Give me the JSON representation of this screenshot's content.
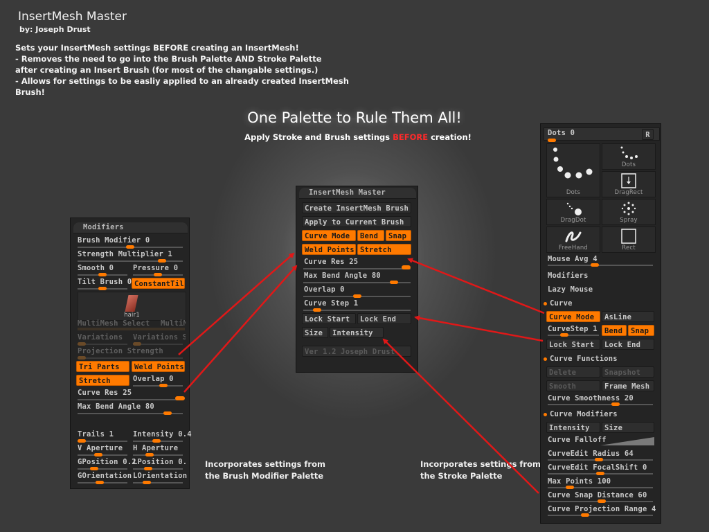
{
  "header": {
    "title": "InsertMesh Master",
    "author": "by: Joseph Drust",
    "description": [
      "Sets your InsertMesh settings BEFORE creating an InsertMesh!",
      "- Removes the need to go into the Brush Palette AND Stroke Palette",
      "after creating an Insert Brush (for most of the changable settings.)",
      "- Allows for settings to be easliy applied to an already created InsertMesh",
      "Brush!"
    ],
    "headline": "One Palette to Rule Them All!",
    "subline_pre": "Apply  Stroke and Brush settings ",
    "subline_accent": "BEFORE",
    "subline_post": " creation!",
    "accent_color": "#ff2a2a"
  },
  "captions": {
    "left_line1": "Incorporates settings from",
    "left_line2": "the Brush Modifier Palette",
    "right_line1": "Incorporates settings from",
    "right_line2": "the Stroke Palette"
  },
  "modifiers_palette": {
    "title": "Modifiers",
    "brush_modifier": "Brush Modifier 0",
    "strength_multiplier": "Strength Multiplier 1",
    "smooth": "Smooth 0",
    "pressure": "Pressure 0",
    "tilt_brush": "Tilt Brush 0",
    "constant_tilt": "ConstantTilt",
    "thumb_name": "hair1",
    "multimesh_select": "MultiMesh Select",
    "multim": "MultiM",
    "variations": "Variations",
    "variations_s": "Variations S",
    "projection_strength": "Projection Strength",
    "tri_parts": "Tri Parts",
    "weld_points": "Weld Points",
    "stretch": "Stretch",
    "overlap": "Overlap 0",
    "curve_res": "Curve Res 25",
    "max_bend_angle": "Max Bend Angle 80",
    "trails": "Trails 1",
    "intensity": "Intensity 0.4",
    "v_aperture": "V Aperture",
    "h_aperture": "H Aperture",
    "gposition": "GPosition 0.2",
    "lposition": "LPosition 0.2",
    "gorientation": "GOrientation",
    "lorientation": "LOrientation"
  },
  "master_palette": {
    "title": "InsertMesh Master",
    "create_button": "Create InsertMesh Brush",
    "apply_button": "Apply to Current Brush",
    "curve_mode": "Curve Mode",
    "bend": "Bend",
    "snap": "Snap",
    "weld_points": "Weld Points",
    "stretch": "Stretch",
    "curve_res": "Curve Res 25",
    "max_bend_angle": "Max Bend Angle 80",
    "overlap": "Overlap 0",
    "curve_step": "Curve Step 1",
    "lock_start": "Lock Start",
    "lock_end": "Lock End",
    "size": "Size",
    "intensity": "Intensity",
    "version": "Ver 1.2 Joseph Drust"
  },
  "stroke_palette": {
    "dots": "Dots 0",
    "r_button": "R",
    "strokes": [
      "Dots",
      "Dots",
      "DragRect",
      "DragDot",
      "Spray",
      "FreeHand",
      "Rect"
    ],
    "mouse_avg": "Mouse Avg 4",
    "modifiers": "Modifiers",
    "lazy_mouse": "Lazy Mouse",
    "curve": "Curve",
    "curve_mode": "Curve Mode",
    "asline": "AsLine",
    "curvestep": "CurveStep 1",
    "bend": "Bend",
    "snap": "Snap",
    "lock_start": "Lock Start",
    "lock_end": "Lock End",
    "curve_functions": "Curve Functions",
    "delete": "Delete",
    "snapshot": "Snapshot",
    "smooth": "Smooth",
    "frame_mesh": "Frame Mesh",
    "curve_smoothness": "Curve Smoothness 20",
    "curve_modifiers": "Curve Modifiers",
    "intensity": "Intensity",
    "size": "Size",
    "curve_falloff": "Curve Falloff",
    "curveedit_radius": "CurveEdit Radius 64",
    "curveedit_focal": "CurveEdit FocalShift 0",
    "max_points": "Max Points 100",
    "curve_snap_distance": "Curve Snap Distance 60",
    "curve_projection_range": "Curve Projection Range 4"
  }
}
